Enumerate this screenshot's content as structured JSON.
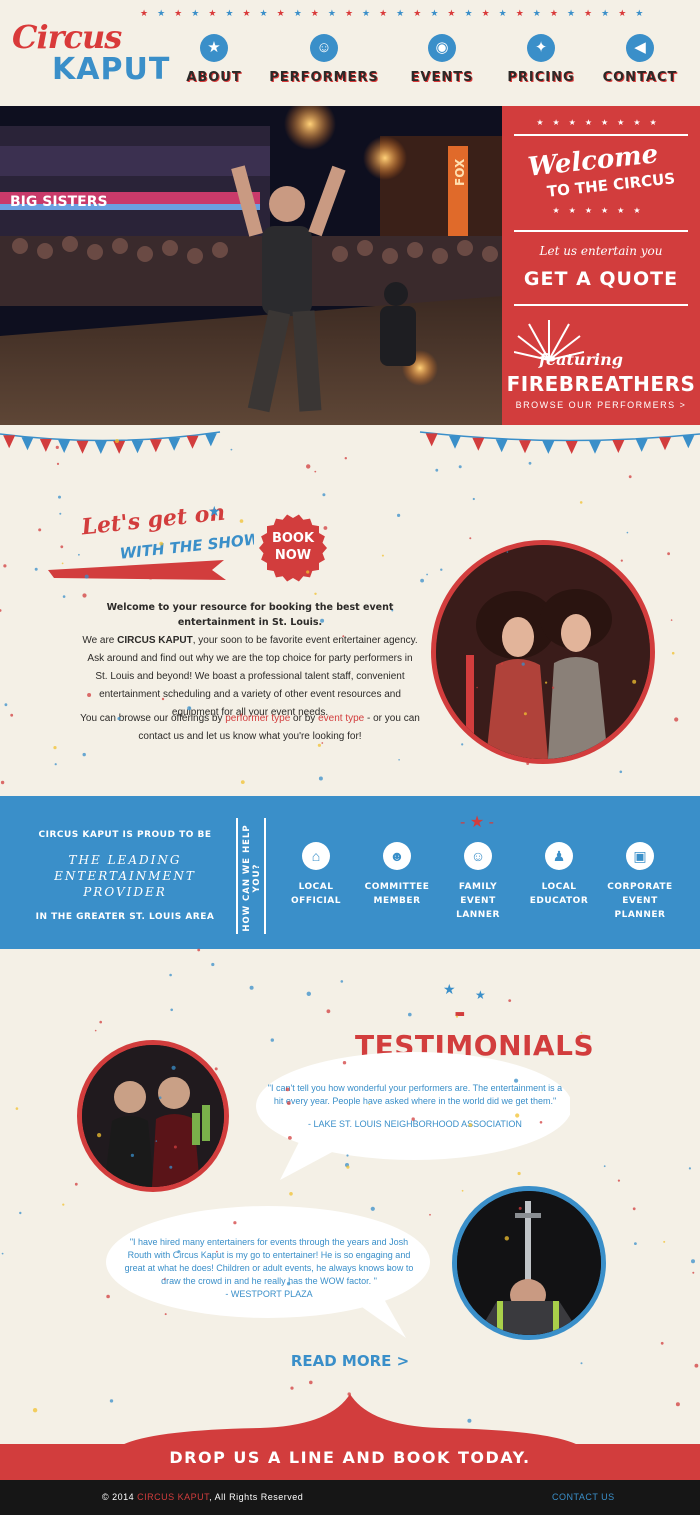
{
  "brand": {
    "logo_line1": "Circus",
    "logo_line2": "KAPUT"
  },
  "nav": [
    {
      "label": "ABOUT",
      "icon": "star-icon",
      "glyph": "★"
    },
    {
      "label": "PERFORMERS",
      "icon": "person-icon",
      "glyph": "☺"
    },
    {
      "label": "EVENTS",
      "icon": "camera-icon",
      "glyph": "◉"
    },
    {
      "label": "PRICING",
      "icon": "magic-wand-icon",
      "glyph": "✦"
    },
    {
      "label": "CONTACT",
      "icon": "megaphone-icon",
      "glyph": "◀"
    }
  ],
  "hero": {
    "photo_sign_text": "BIG SISTERS",
    "marquee_text": "FOX",
    "welcome_line1": "Welcome",
    "welcome_line2": "TO THE CIRCUS",
    "entertain_text": "Let us entertain you",
    "quote_button": "GET A QUOTE",
    "featuring": "featuring",
    "featured_act": "FIREBREATHERS",
    "browse_link": "BROWSE OUR PERFORMERS >"
  },
  "intro": {
    "headline1": "Let's get on",
    "headline2": "WITH THE SHOW",
    "book_badge_line1": "BOOK",
    "book_badge_line2": "NOW",
    "lead": "Welcome to your resource for booking the best event entertainment in St. Louis.",
    "para1_start": "We are ",
    "para1_brand": "CIRCUS KAPUT",
    "para1_rest": ", your soon to be favorite event entertainer agency. Ask around and find out why we are the top choice for party performers in St. Louis and beyond! We boast a professional talent staff, convenient entertainment scheduling and a variety of other event resources and equipment for all your event needs.",
    "para2_start": "You can browse our offerings by ",
    "link_performer": "performer type",
    "para2_mid": " or by ",
    "link_event": "event type",
    "para2_end": " - or you can contact us and let us know what you're looking for!"
  },
  "band": {
    "proud": "CIRCUS KAPUT IS PROUD TO BE",
    "leading": "THE LEADING ENTERTAINMENT PROVIDER",
    "area": "IN THE GREATER ST. LOUIS AREA",
    "vertical": "HOW CAN WE HELP YOU?",
    "items": [
      {
        "label": "LOCAL OFFICIAL",
        "icon": "building-icon",
        "glyph": "⌂"
      },
      {
        "label": "COMMITTEE MEMBER",
        "icon": "group-icon",
        "glyph": "☻"
      },
      {
        "label": "FAMILY EVENT LANNER",
        "icon": "smiley-icon",
        "glyph": "☺"
      },
      {
        "label": "LOCAL EDUCATOR",
        "icon": "teacher-icon",
        "glyph": "♟"
      },
      {
        "label": "CORPORATE EVENT PLANNER",
        "icon": "briefcase-icon",
        "glyph": "▣"
      }
    ]
  },
  "testimonials": {
    "title": "TESTIMONIALS",
    "quote1": "\"I can't tell you how wonderful your performers are. The entertainment is a hit every year. People have asked where in the world did we get them.\"",
    "source1": "- LAKE ST. LOUIS NEIGHBORHOOD ASSOCIATION",
    "quote2": "\"I have hired many entertainers for events through the years and Josh Routh with Circus Kaput is my go to entertainer! He is so engaging and great at what he does! Children or adult events, he always knows how to draw the crowd in and he really has the WOW factor. \"",
    "source2": "- WESTPORT PLAZA",
    "read_more": "READ MORE >"
  },
  "cta": {
    "label": "DROP US A LINE AND BOOK TODAY."
  },
  "footer": {
    "copy_prefix": "© 2014 ",
    "copy_brand": "CIRCUS KAPUT",
    "copy_suffix": ", All Rights Reserved",
    "contact_link": "CONTACT US"
  },
  "colors": {
    "red": "#d23d3d",
    "blue": "#3a8fc9",
    "cream": "#f4f0e6",
    "dark": "#161616"
  }
}
